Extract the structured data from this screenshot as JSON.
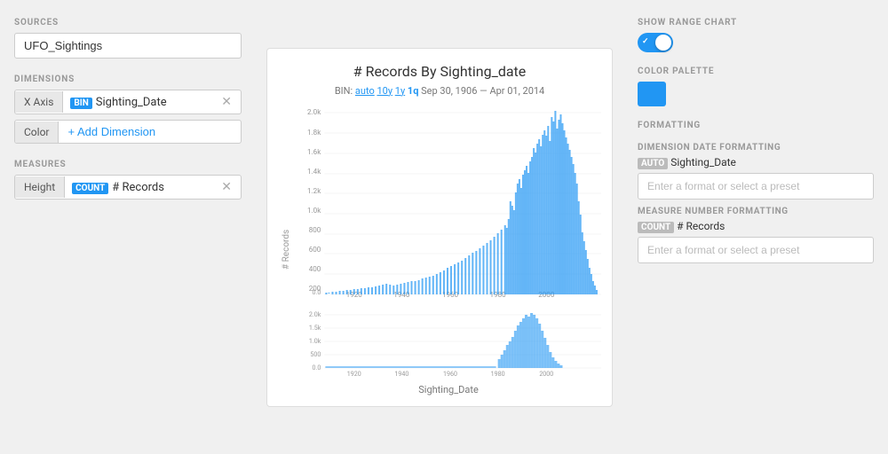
{
  "left": {
    "sources_label": "SOURCES",
    "source_value": "UFO_Sightings",
    "dimensions_label": "DIMENSIONS",
    "xaxis_label": "X Axis",
    "xaxis_tag": "BIN",
    "xaxis_field": "Sighting_Date",
    "color_label": "Color",
    "add_dimension": "+ Add Dimension",
    "measures_label": "MEASURES",
    "height_label": "Height",
    "height_tag": "COUNT",
    "height_field": "# Records"
  },
  "chart": {
    "title": "# Records By Sighting_date",
    "bin_prefix": "BIN:",
    "bin_auto": "auto",
    "bin_10y": "10y",
    "bin_1y": "1y",
    "bin_1q": "1q",
    "date_range": "Sep 30, 1906 — Apr 01, 2014",
    "y_label": "# Records",
    "x_label": "Sighting_Date",
    "y_ticks_main": [
      "2.0k",
      "1.8k",
      "1.6k",
      "1.4k",
      "1.2k",
      "1.0k",
      "800",
      "600",
      "400",
      "200",
      "0.0"
    ],
    "y_ticks_range": [
      "2.0k",
      "1.5k",
      "1.0k",
      "500",
      "0.0"
    ],
    "x_ticks": [
      "1920",
      "1940",
      "1960",
      "1980",
      "2000"
    ]
  },
  "right": {
    "show_range_label": "SHOW RANGE CHART",
    "color_palette_label": "COLOR PALETTE",
    "formatting_label": "FORMATTING",
    "dim_date_label": "DIMENSION DATE FORMATTING",
    "dim_date_tag": "AUTO",
    "dim_date_field": "Sighting_Date",
    "dim_date_placeholder": "Enter a format or select a preset",
    "measure_num_label": "MEASURE NUMBER FORMATTING",
    "measure_num_tag": "COUNT",
    "measure_num_field": "# Records",
    "measure_num_placeholder": "Enter a format or select a preset"
  },
  "colors": {
    "blue": "#2196f3",
    "toggle_bg": "#2196f3"
  }
}
